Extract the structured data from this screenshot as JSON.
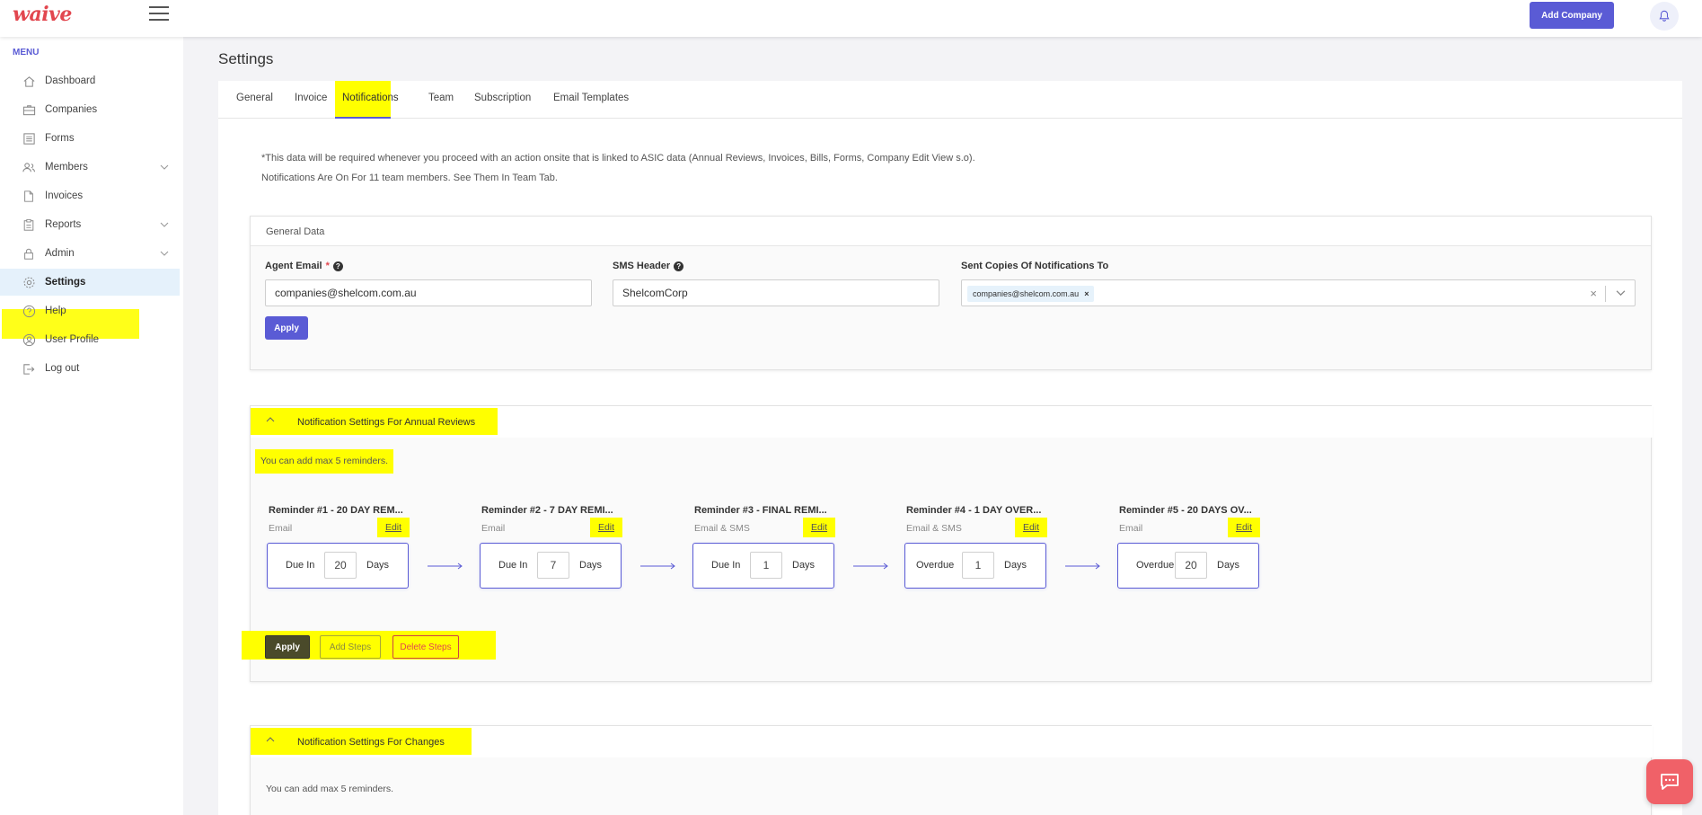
{
  "header": {
    "logo": "waive",
    "add_company_label": "Add Company"
  },
  "sidebar": {
    "menu_label": "MENU",
    "items": [
      {
        "label": "Dashboard",
        "icon": "home-icon"
      },
      {
        "label": "Companies",
        "icon": "briefcase-icon"
      },
      {
        "label": "Forms",
        "icon": "form-icon"
      },
      {
        "label": "Members",
        "icon": "users-icon",
        "has_submenu": true
      },
      {
        "label": "Invoices",
        "icon": "document-icon"
      },
      {
        "label": "Reports",
        "icon": "clipboard-icon",
        "has_submenu": true
      },
      {
        "label": "Admin",
        "icon": "lock-icon",
        "has_submenu": true
      },
      {
        "label": "Settings",
        "icon": "gear-icon",
        "active": true
      },
      {
        "label": "Help",
        "icon": "help-icon"
      },
      {
        "label": "User Profile",
        "icon": "user-icon"
      },
      {
        "label": "Log out",
        "icon": "logout-icon"
      }
    ]
  },
  "page": {
    "title": "Settings",
    "tabs": [
      "General",
      "Invoice",
      "Notifications",
      "Team",
      "Subscription",
      "Email Templates"
    ],
    "active_tab": "Notifications",
    "intro_line1": "*This data will be required whenever you proceed with an action onsite that is linked to ASIC data (Annual Reviews, Invoices, Bills, Forms, Company Edit View s.o).",
    "intro_line2": "Notifications Are On For 11 team members. See Them In Team Tab."
  },
  "general_data": {
    "title": "General Data",
    "agent_email_label": "Agent Email",
    "agent_email_required": "*",
    "agent_email_value": "companies@shelcom.com.au",
    "sms_header_label": "SMS Header",
    "sms_header_value": "ShelcomCorp",
    "sent_copies_label": "Sent Copies Of Notifications To",
    "sent_copies_chip": "companies@shelcom.com.au",
    "chip_remove": "×",
    "clear": "×",
    "apply_label": "Apply"
  },
  "annual_reviews": {
    "title": "Notification Settings For Annual Reviews",
    "note": "You can add max 5 reminders.",
    "edit_label": "Edit",
    "days_label": "Days",
    "reminders": [
      {
        "title": "Reminder #1 - 20 DAY REM...",
        "type": "Email",
        "label": "Due In",
        "value": "20"
      },
      {
        "title": "Reminder #2 - 7 DAY REMI...",
        "type": "Email",
        "label": "Due In",
        "value": "7"
      },
      {
        "title": "Reminder #3 - FINAL REMI...",
        "type": "Email & SMS",
        "label": "Due In",
        "value": "1"
      },
      {
        "title": "Reminder #4 - 1 DAY OVER...",
        "type": "Email & SMS",
        "label": "Overdue",
        "value": "1"
      },
      {
        "title": "Reminder #5 - 20 DAYS OV...",
        "type": "Email",
        "label": "Overdue",
        "value": "20"
      }
    ],
    "apply_label": "Apply",
    "add_steps_label": "Add Steps",
    "delete_steps_label": "Delete Steps"
  },
  "changes": {
    "title": "Notification Settings For Changes",
    "note": "You can add max 5 reminders."
  },
  "colors": {
    "accent": "#5a5bd5",
    "brand": "#e2474f",
    "highlight": "#ffff00"
  }
}
